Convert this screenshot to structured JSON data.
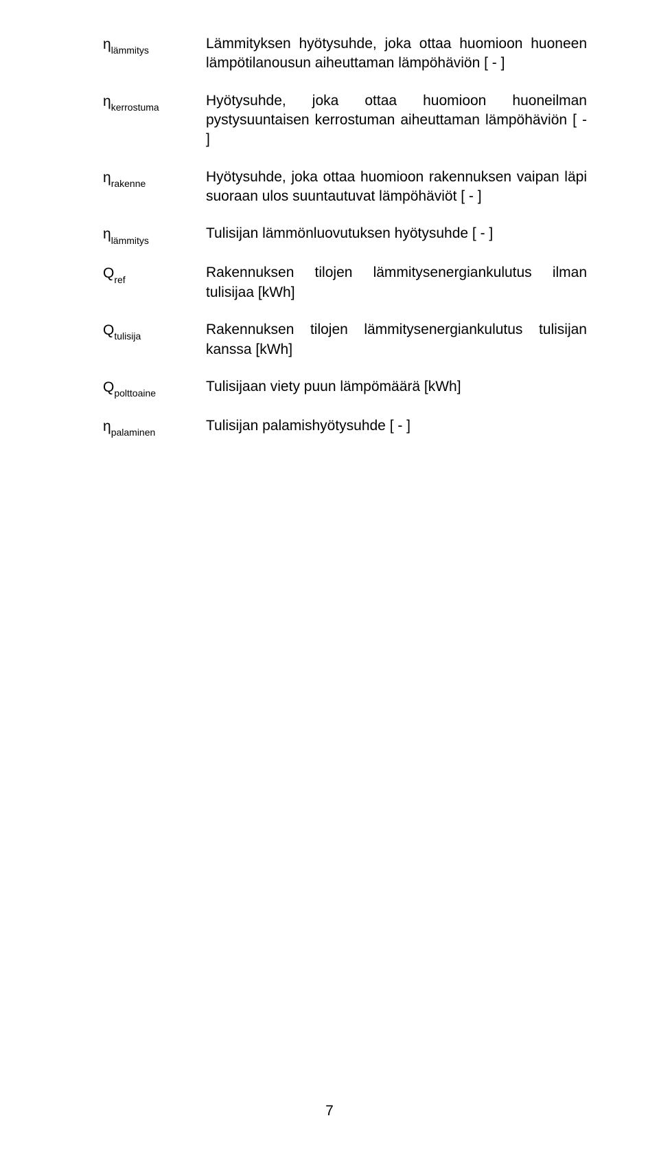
{
  "rows": [
    {
      "termSymbol": "η",
      "termSub": "lämmitys",
      "def": "Lämmityksen hyötysuhde, joka ottaa huomioon huoneen lämpötilanousun aiheuttaman lämpöhäviön [ - ]"
    },
    {
      "termSymbol": "η",
      "termSub": "kerrostuma",
      "def": "Hyötysuhde, joka ottaa huomioon huoneilman pystysuuntaisen kerrostuman aiheuttaman lämpöhäviön [ - ]"
    },
    {
      "termSymbol": "η",
      "termSub": "rakenne",
      "def": "Hyötysuhde, joka ottaa huomioon rakennuksen vaipan läpi suoraan ulos suuntautuvat lämpöhäviöt [ - ]"
    },
    {
      "termSymbol": "η",
      "termSub": "lämmitys",
      "def": "Tulisijan lämmönluovutuksen hyötysuhde [ - ]"
    },
    {
      "termSymbol": "Q",
      "termSub": "ref",
      "def": "Rakennuksen tilojen lämmitysenergiankulutus ilman tulisijaa [kWh]"
    },
    {
      "termSymbol": "Q",
      "termSub": "tulisija",
      "def": "Rakennuksen tilojen lämmitysenergiankulutus tulisijan kanssa [kWh]"
    },
    {
      "termSymbol": "Q",
      "termSub": "polttoaine",
      "def": "Tulisijaan viety puun lämpömäärä [kWh]"
    },
    {
      "termSymbol": "η",
      "termSub": "palaminen",
      "def": "Tulisijan palamishyötysuhde [ - ]"
    }
  ],
  "pageNumber": "7"
}
